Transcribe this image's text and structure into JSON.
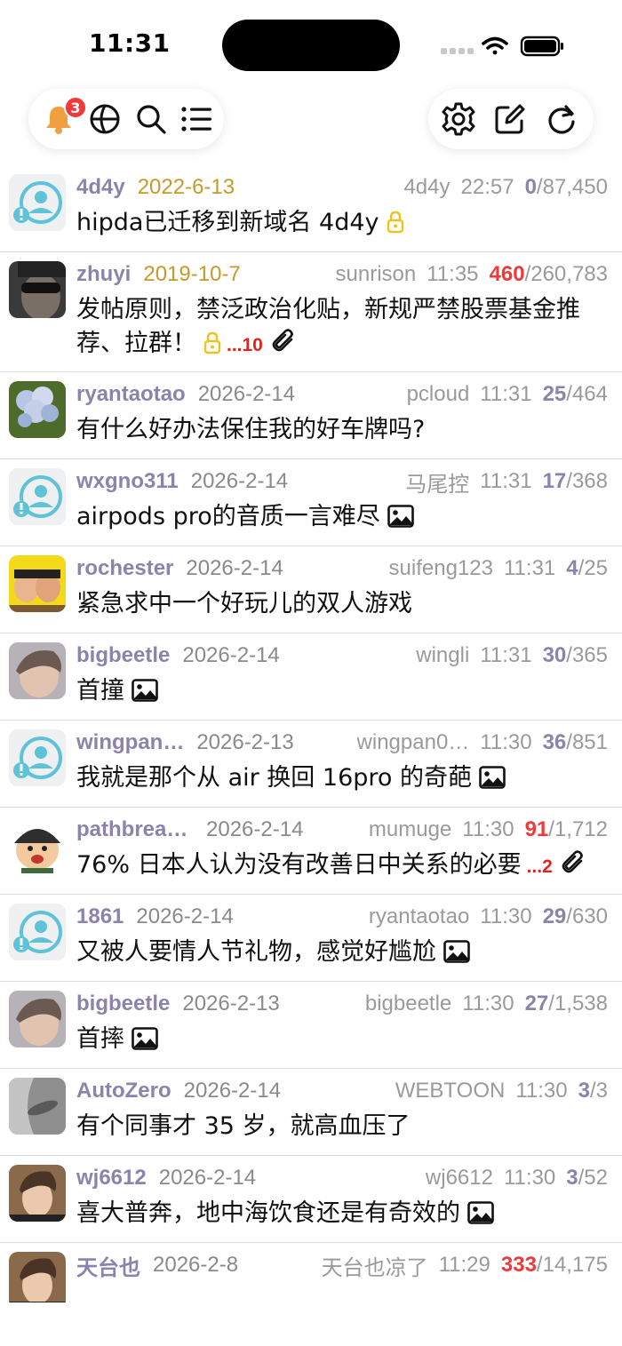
{
  "status_bar": {
    "time": "11:31"
  },
  "toolbar": {
    "notification_badge": "3"
  },
  "threads": [
    {
      "author": "4d4y",
      "date": "2022-6-13",
      "date_color": "gold",
      "last_poster": "4d4y",
      "time": "22:57",
      "replies": "0",
      "replies_hot": false,
      "views": "87,450",
      "title": "hipda已迁移到新域名 4d4y",
      "locked": true,
      "pages": "",
      "attachment": false,
      "image": false,
      "avatar": "default"
    },
    {
      "author": "zhuyi",
      "date": "2019-10-7",
      "date_color": "gold",
      "last_poster": "sunrison",
      "time": "11:35",
      "replies": "460",
      "replies_hot": true,
      "views": "260,783",
      "title": "发帖原则，禁泛政治化贴，新规严禁股票基金推荐、拉群！",
      "locked": true,
      "pages": "...10",
      "attachment": true,
      "image": false,
      "avatar": "dark-glasses"
    },
    {
      "author": "ryantaotao",
      "date": "2026-2-14",
      "date_color": "gray",
      "last_poster": "pcloud",
      "time": "11:31",
      "replies": "25",
      "replies_hot": false,
      "views": "464",
      "title": "有什么好办法保住我的好车牌吗?",
      "locked": false,
      "pages": "",
      "attachment": false,
      "image": false,
      "avatar": "flower"
    },
    {
      "author": "wxgno311",
      "date": "2026-2-14",
      "date_color": "gray",
      "last_poster": "马尾控",
      "time": "11:31",
      "replies": "17",
      "replies_hot": false,
      "views": "368",
      "title": "airpods pro的音质一言难尽",
      "locked": false,
      "pages": "",
      "attachment": false,
      "image": true,
      "avatar": "default"
    },
    {
      "author": "rochester",
      "date": "2026-2-14",
      "date_color": "gray",
      "last_poster": "suifeng123",
      "time": "11:31",
      "replies": "4",
      "replies_hot": false,
      "views": "25",
      "title": "紧急求中一个好玩儿的双人游戏",
      "locked": false,
      "pages": "",
      "attachment": false,
      "image": false,
      "avatar": "yellow-faces"
    },
    {
      "author": "bigbeetle",
      "date": "2026-2-14",
      "date_color": "gray",
      "last_poster": "wingli",
      "time": "11:31",
      "replies": "30",
      "replies_hot": false,
      "views": "365",
      "title": "首撞",
      "locked": false,
      "pages": "",
      "attachment": false,
      "image": true,
      "avatar": "child"
    },
    {
      "author": "wingpan…",
      "date": "2026-2-13",
      "date_color": "gray",
      "last_poster": "wingpan0…",
      "time": "11:30",
      "replies": "36",
      "replies_hot": false,
      "views": "851",
      "title": "我就是那个从 air 换回 16pro 的奇葩",
      "locked": false,
      "pages": "",
      "attachment": false,
      "image": true,
      "avatar": "default"
    },
    {
      "author": "pathbreaker",
      "date": "2026-2-14",
      "date_color": "gray",
      "last_poster": "mumuge",
      "time": "11:30",
      "replies": "91",
      "replies_hot": true,
      "views": "1,712",
      "title": "76% 日本人认为没有改善日中关系的必要",
      "locked": false,
      "pages": "...2",
      "attachment": true,
      "image": false,
      "avatar": "cartoon"
    },
    {
      "author": "1861",
      "date": "2026-2-14",
      "date_color": "gray",
      "last_poster": "ryantaotao",
      "time": "11:30",
      "replies": "29",
      "replies_hot": false,
      "views": "630",
      "title": "又被人要情人节礼物，感觉好尴尬",
      "locked": false,
      "pages": "",
      "attachment": false,
      "image": true,
      "avatar": "default"
    },
    {
      "author": "bigbeetle",
      "date": "2026-2-13",
      "date_color": "gray",
      "last_poster": "bigbeetle",
      "time": "11:30",
      "replies": "27",
      "replies_hot": false,
      "views": "1,538",
      "title": "首摔",
      "locked": false,
      "pages": "",
      "attachment": false,
      "image": true,
      "avatar": "child"
    },
    {
      "author": "AutoZero",
      "date": "2026-2-14",
      "date_color": "gray",
      "last_poster": "WEBTOON",
      "time": "11:30",
      "replies": "3",
      "replies_hot": false,
      "views": "3",
      "title": "有个同事才 35 岁，就高血压了",
      "locked": false,
      "pages": "",
      "attachment": false,
      "image": false,
      "avatar": "car-handle"
    },
    {
      "author": "wj6612",
      "date": "2026-2-14",
      "date_color": "gray",
      "last_poster": "wj6612",
      "time": "11:30",
      "replies": "3",
      "replies_hot": false,
      "views": "52",
      "title": "喜大普奔，地中海饮食还是有奇效的",
      "locked": false,
      "pages": "",
      "attachment": false,
      "image": true,
      "avatar": "man-portrait"
    },
    {
      "author": "天台也",
      "date": "2026-2-8",
      "date_color": "gray",
      "last_poster": "天台也凉了",
      "time": "11:29",
      "replies": "333",
      "replies_hot": true,
      "views": "14,175",
      "title": "",
      "locked": false,
      "pages": "",
      "attachment": false,
      "image": false,
      "avatar": "man-portrait"
    }
  ]
}
